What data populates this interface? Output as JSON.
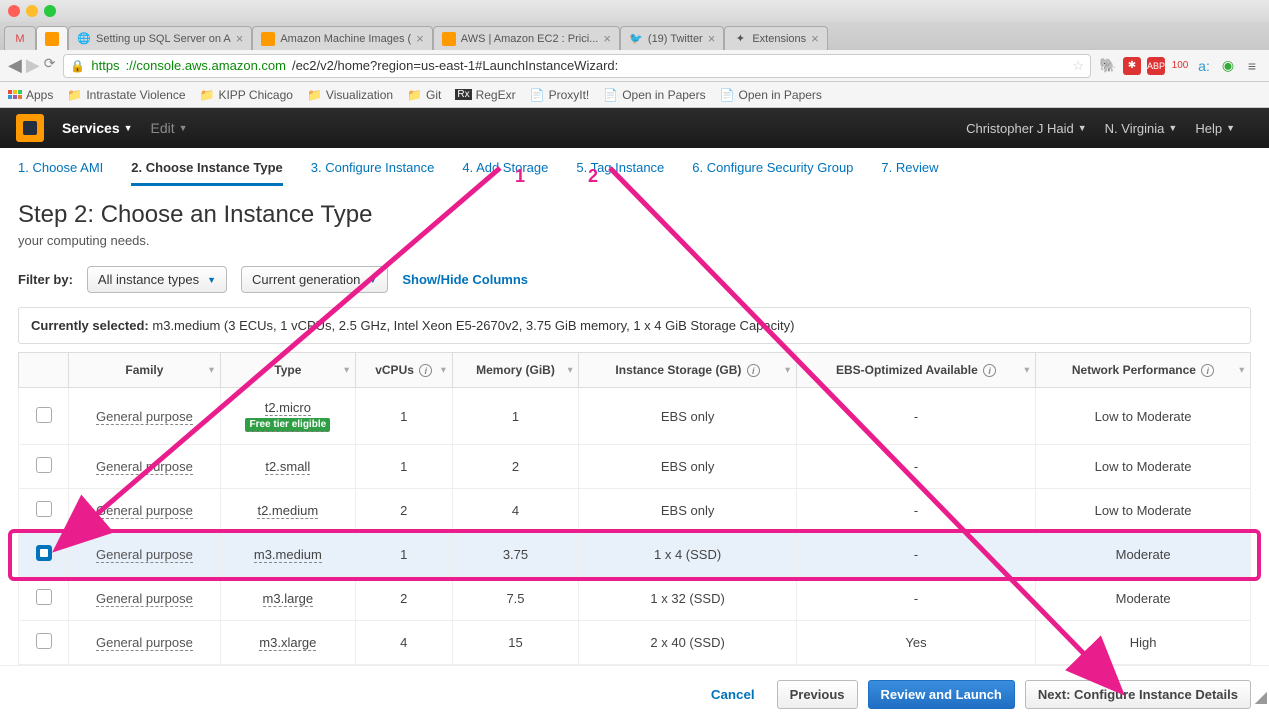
{
  "browser": {
    "tabs": [
      {
        "label": "",
        "icon": "gmail"
      },
      {
        "label": "",
        "icon": "aws-box"
      },
      {
        "label": "Setting up SQL Server on A"
      },
      {
        "label": "Amazon Machine Images ("
      },
      {
        "label": "AWS | Amazon EC2 : Prici..."
      },
      {
        "label": "(19) Twitter"
      },
      {
        "label": "Extensions"
      }
    ],
    "url_secure": "https",
    "url_host": "://console.aws.amazon.com",
    "url_path": "/ec2/v2/home?region=us-east-1#LaunchInstanceWizard:",
    "bookmarks_label": "Apps",
    "bookmarks": [
      "Intrastate Violence",
      "KIPP Chicago",
      "Visualization",
      "Git",
      "RegExr",
      "ProxyIt!",
      "Open in Papers",
      "Open in Papers"
    ]
  },
  "aws_nav": {
    "services": "Services",
    "edit": "Edit",
    "user": "Christopher J Haid",
    "region": "N. Virginia",
    "help": "Help"
  },
  "wizard_tabs": [
    "1. Choose AMI",
    "2. Choose Instance Type",
    "3. Configure Instance",
    "4. Add Storage",
    "5. Tag Instance",
    "6. Configure Security Group",
    "7. Review"
  ],
  "heading": "Step 2: Choose an Instance Type",
  "subheading": "your computing needs.",
  "filter": {
    "label": "Filter by:",
    "dd1": "All instance types",
    "dd2": "Current generation",
    "link": "Show/Hide Columns"
  },
  "selected_label": "Currently selected:",
  "selected_text": "m3.medium (3 ECUs, 1 vCPUs, 2.5 GHz, Intel Xeon E5-2670v2, 3.75 GiB memory, 1 x 4 GiB Storage Capacity)",
  "columns": [
    "Family",
    "Type",
    "vCPUs",
    "Memory (GiB)",
    "Instance Storage (GB)",
    "EBS-Optimized Available",
    "Network Performance"
  ],
  "free_tier_label": "Free tier eligible",
  "rows": [
    {
      "sel": false,
      "family": "General purpose",
      "type": "t2.micro",
      "free": true,
      "vcpu": "1",
      "mem": "1",
      "storage": "EBS only",
      "ebs": "-",
      "net": "Low to Moderate"
    },
    {
      "sel": false,
      "family": "General purpose",
      "type": "t2.small",
      "free": false,
      "vcpu": "1",
      "mem": "2",
      "storage": "EBS only",
      "ebs": "-",
      "net": "Low to Moderate"
    },
    {
      "sel": false,
      "family": "General purpose",
      "type": "t2.medium",
      "free": false,
      "vcpu": "2",
      "mem": "4",
      "storage": "EBS only",
      "ebs": "-",
      "net": "Low to Moderate"
    },
    {
      "sel": true,
      "family": "General purpose",
      "type": "m3.medium",
      "free": false,
      "vcpu": "1",
      "mem": "3.75",
      "storage": "1 x 4 (SSD)",
      "ebs": "-",
      "net": "Moderate"
    },
    {
      "sel": false,
      "family": "General purpose",
      "type": "m3.large",
      "free": false,
      "vcpu": "2",
      "mem": "7.5",
      "storage": "1 x 32 (SSD)",
      "ebs": "-",
      "net": "Moderate"
    },
    {
      "sel": false,
      "family": "General purpose",
      "type": "m3.xlarge",
      "free": false,
      "vcpu": "4",
      "mem": "15",
      "storage": "2 x 40 (SSD)",
      "ebs": "Yes",
      "net": "High"
    }
  ],
  "footer": {
    "cancel": "Cancel",
    "previous": "Previous",
    "review": "Review and Launch",
    "next": "Next: Configure Instance Details"
  },
  "annotations": {
    "n1": "1",
    "n2": "2"
  }
}
